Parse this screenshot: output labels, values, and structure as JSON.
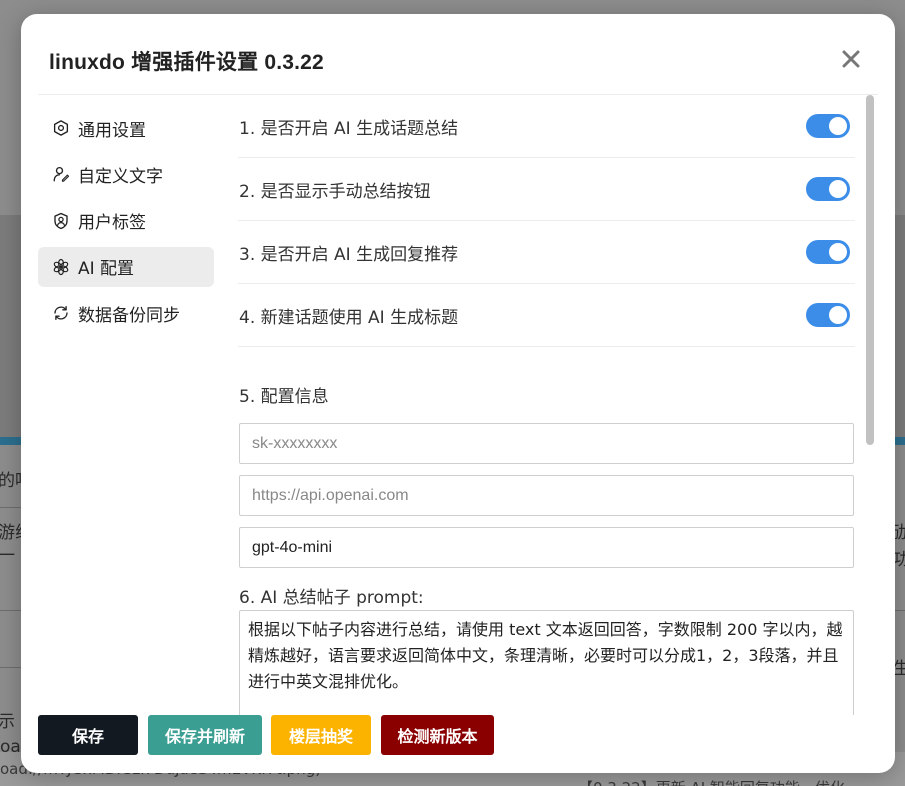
{
  "modal": {
    "title": "linuxdo 增强插件设置 0.3.22",
    "close_symbol": "×"
  },
  "sidebar": {
    "items": [
      {
        "label": "通用设置",
        "icon": "gear-icon",
        "active": false
      },
      {
        "label": "自定义文字",
        "icon": "user-edit-icon",
        "active": false
      },
      {
        "label": "用户标签",
        "icon": "user-badge-icon",
        "active": false
      },
      {
        "label": "AI 配置",
        "icon": "ai-flower-icon",
        "active": true
      },
      {
        "label": "数据备份同步",
        "icon": "sync-icon",
        "active": false
      }
    ]
  },
  "settings": {
    "toggles": [
      {
        "label": "1. 是否开启 AI 生成话题总结",
        "on": true
      },
      {
        "label": "2. 是否显示手动总结按钮",
        "on": true
      },
      {
        "label": "3. 是否开启 AI 生成回复推荐",
        "on": true
      },
      {
        "label": "4. 新建话题使用 AI 生成标题",
        "on": true
      }
    ],
    "config_label": "5. 配置信息",
    "api_key_placeholder": "sk-xxxxxxxx",
    "api_url_placeholder": "https://api.openai.com",
    "model_value": "gpt-4o-mini",
    "prompt_label": "6. AI 总结帖子 prompt:",
    "prompt_value": "根据以下帖子内容进行总结，请使用 text 文本返回回答，字数限制 200 字以内，越精炼越好，语言要求返回简体中文，条理清晰，必要时可以分成1，2，3段落，并且进行中英文混排优化。"
  },
  "footer": {
    "save": "保存",
    "save_refresh": "保存并刷新",
    "lottery": "楼层抽奖",
    "check_update": "检测新版本"
  },
  "colors": {
    "toggle_on": "#3b8de8",
    "save_btn": "#121920",
    "save_refresh_btn": "#3a9e93",
    "lottery_btn": "#fcb300",
    "check_update_btn": "#8a0000"
  },
  "background": {
    "fragments": [
      "的吗",
      "游线",
      "一",
      "示",
      "oad://",
      "oad://fnTJGxMDIGzl7DuJaeS4mEVKf7t.png)",
      "【0.3.22】更新 AI 智能回复功能，优化",
      "劢",
      "功",
      "生"
    ]
  }
}
